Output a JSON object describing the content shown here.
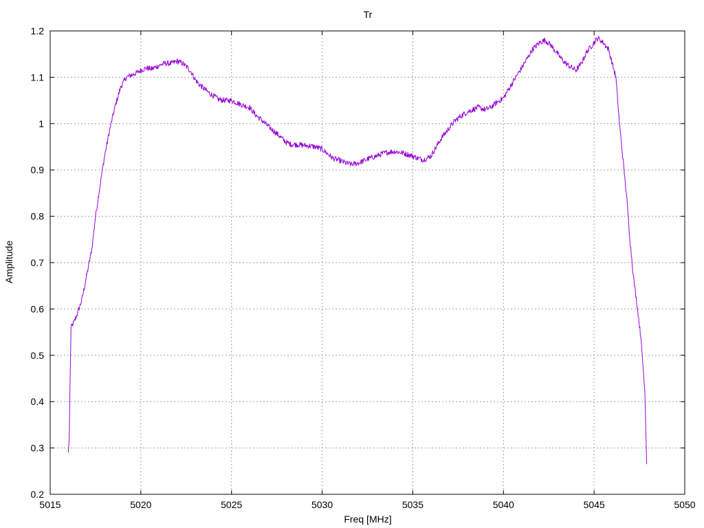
{
  "chart_data": {
    "type": "line",
    "title": "Tr",
    "xlabel": "Freq [MHz]",
    "ylabel": "Amplitude",
    "xlim": [
      5015,
      5050
    ],
    "ylim": [
      0.2,
      1.2
    ],
    "xticks": [
      5015,
      5020,
      5025,
      5030,
      5035,
      5040,
      5045,
      5050
    ],
    "yticks": [
      0.2,
      0.3,
      0.4,
      0.5,
      0.6,
      0.7,
      0.8,
      0.9,
      1,
      1.1,
      1.2
    ],
    "xtick_labels": [
      "5015",
      "5020",
      "5025",
      "5030",
      "5035",
      "5040",
      "5045",
      "5050"
    ],
    "ytick_labels": [
      "0.2",
      "0.3",
      "0.4",
      "0.5",
      "0.6",
      "0.7",
      "0.8",
      "0.9",
      "1",
      "1.1",
      "1.2"
    ],
    "grid": true,
    "legend": "none",
    "series": [
      {
        "color": "#9400d3",
        "x": [
          5016.0,
          5016.05,
          5016.1,
          5016.15,
          5016.3,
          5016.5,
          5016.75,
          5017.0,
          5017.3,
          5017.5,
          5017.8,
          5018.0,
          5018.3,
          5018.6,
          5018.9,
          5019.2,
          5019.5,
          5019.8,
          5020.0,
          5020.3,
          5020.6,
          5021.0,
          5021.3,
          5021.7,
          5022.0,
          5022.3,
          5022.6,
          5022.8,
          5023.0,
          5023.2,
          5023.5,
          5023.8,
          5024.0,
          5024.3,
          5024.6,
          5025.0,
          5025.3,
          5025.6,
          5026.0,
          5026.3,
          5026.6,
          5027.0,
          5027.3,
          5027.6,
          5028.0,
          5028.3,
          5028.6,
          5029.0,
          5029.3,
          5029.6,
          5030.0,
          5030.3,
          5030.6,
          5031.0,
          5031.3,
          5031.6,
          5032.0,
          5032.3,
          5032.6,
          5033.0,
          5033.3,
          5033.6,
          5034.0,
          5034.3,
          5034.6,
          5035.0,
          5035.3,
          5035.6,
          5036.0,
          5036.3,
          5036.6,
          5037.0,
          5037.3,
          5037.6,
          5038.0,
          5038.3,
          5038.6,
          5039.0,
          5039.3,
          5039.6,
          5040.0,
          5040.3,
          5040.6,
          5041.0,
          5041.3,
          5041.6,
          5042.0,
          5042.3,
          5042.6,
          5043.0,
          5043.3,
          5043.6,
          5044.0,
          5044.3,
          5044.6,
          5045.0,
          5045.2,
          5045.5,
          5045.8,
          5046.0,
          5046.2,
          5046.4,
          5046.6,
          5046.8,
          5047.0,
          5047.2,
          5047.4,
          5047.6,
          5047.8,
          5047.9
        ],
        "y": [
          0.29,
          0.32,
          0.45,
          0.56,
          0.57,
          0.59,
          0.62,
          0.67,
          0.73,
          0.8,
          0.88,
          0.93,
          0.99,
          1.04,
          1.08,
          1.1,
          1.105,
          1.11,
          1.115,
          1.12,
          1.118,
          1.125,
          1.13,
          1.13,
          1.135,
          1.13,
          1.12,
          1.11,
          1.095,
          1.085,
          1.075,
          1.065,
          1.06,
          1.052,
          1.05,
          1.05,
          1.045,
          1.04,
          1.035,
          1.02,
          1.01,
          0.995,
          0.985,
          0.975,
          0.96,
          0.955,
          0.955,
          0.953,
          0.952,
          0.95,
          0.945,
          0.935,
          0.925,
          0.92,
          0.915,
          0.912,
          0.915,
          0.92,
          0.925,
          0.93,
          0.935,
          0.938,
          0.94,
          0.938,
          0.935,
          0.93,
          0.925,
          0.922,
          0.93,
          0.95,
          0.97,
          0.99,
          1.005,
          1.015,
          1.025,
          1.03,
          1.035,
          1.03,
          1.035,
          1.045,
          1.055,
          1.075,
          1.095,
          1.12,
          1.14,
          1.16,
          1.175,
          1.18,
          1.17,
          1.15,
          1.135,
          1.125,
          1.115,
          1.13,
          1.155,
          1.175,
          1.185,
          1.175,
          1.16,
          1.13,
          1.1,
          1.0,
          0.92,
          0.84,
          0.74,
          0.66,
          0.6,
          0.53,
          0.42,
          0.265
        ]
      }
    ]
  }
}
